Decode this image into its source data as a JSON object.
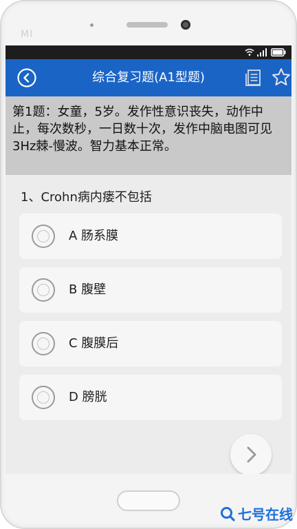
{
  "device": {
    "brand": "MI"
  },
  "status_bar": {
    "icons": [
      "wifi-icon",
      "signal-icon",
      "battery-icon"
    ]
  },
  "app_bar": {
    "title": "综合复习题(A1型题)",
    "icons": [
      "back-circle-icon",
      "notes-icon",
      "star-icon"
    ],
    "color": "#1a64c6"
  },
  "stem": {
    "text": "第1题：女童，5岁。发作性意识丧失，动作中止，每次数秒，一日数十次，发作中脑电图可见3Hz棘-慢波。智力基本正常。"
  },
  "question": {
    "title": "1、Crohn病内瘘不包括",
    "options": [
      {
        "label": "A  肠系膜"
      },
      {
        "label": "B  腹壁"
      },
      {
        "label": "C  腹膜后"
      },
      {
        "label": "D  膀胱"
      }
    ]
  },
  "navigation": {
    "next_icon": "chevron-right-icon"
  },
  "watermark": {
    "text": "七号在线"
  }
}
